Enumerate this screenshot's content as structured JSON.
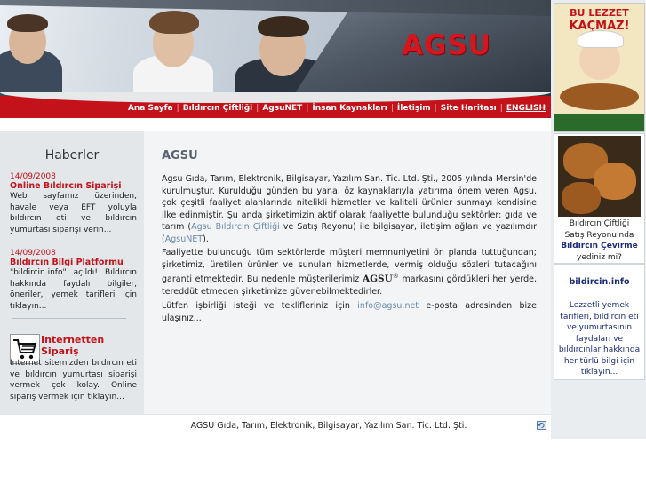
{
  "brand": {
    "logo_text": "AGSU",
    "accent_red": "#c4121a",
    "nav_blue_text": "#1a2a7a"
  },
  "nav": {
    "items": [
      "Ana Sayfa",
      "Bıldırcın Çiftliği",
      "AgsuNET",
      "İnsan Kaynakları",
      "İletişim",
      "Site Haritası",
      "ENGLISH"
    ]
  },
  "sidebar": {
    "heading": "Haberler",
    "news": [
      {
        "date": "14/09/2008",
        "title": "Online Bıldırcın Siparişi",
        "body": "Web sayfamız üzerinden, havale veya EFT yoluyla bıldırcın eti ve bıldırcın yumurtası siparişi verin..."
      },
      {
        "date": "14/09/2008",
        "title": "Bıldırcın Bilgi Platformu",
        "body": "\"bildircin.info\" açıldı! Bıldırcın hakkında faydalı bilgiler, öneriler, yemek tarifleri için tıklayın..."
      }
    ],
    "promo": {
      "icon": "shopping-cart-icon",
      "title": "Internetten Sipariş",
      "body": "Internet sitemizden bıldırcın eti ve bıldırcın yumurtası siparişi vermek çok kolay. Online sipariş vermek için tıklayın..."
    }
  },
  "main": {
    "title": "AGSU",
    "p1_a": "Agsu Gıda, Tarım, Elektronik, Bilgisayar, Yazılım San. Tic. Ltd. Şti., 2005 yılında Mersin'de kurulmuştur. Kurulduğu günden bu yana, öz kaynaklarıyla yatırıma önem veren Agsu, çok çeşitli faaliyet alanlarında nitelikli hizmetler ve kaliteli ürünler sunmayı kendisine ilke edinmiştir. Şu anda şirketimizin aktif olarak faaliyette bulunduğu sektörler: gıda ve tarım (",
    "p1_link1": "Agsu Bıldırcın Çiftliği",
    "p1_b": " ve Satış Reyonu) ile bilgisayar, iletişim ağları ve yazılımdır (",
    "p1_link2": "AgsuNET",
    "p1_c": ").",
    "p2_a": "Faaliyette bulunduğu tüm sektörlerde müşteri memnuniyetini ön planda tuttuğundan; şirketimiz, üretilen ürünler ve sunulan hizmetlerde, vermiş olduğu sözleri tutacağını garanti etmektedir. Bu nedenle müşterilerimiz ",
    "p2_brand": "AGSU",
    "p2_reg": "®",
    "p2_b": " markasını gördükleri her yerde, tereddüt etmeden şirketimize güvenebilmektedirler.",
    "p3_a": "Lütfen işbirliği isteği ve teklifleriniz için ",
    "p3_email": "info@agsu.net",
    "p3_b": " e-posta adresinden bize ulaşınız..."
  },
  "footer": {
    "text": "AGSU Gıda, Tarım, Elektronik, Bilgisayar, Yazılım San. Tic. Ltd. Şti.",
    "icon": "refresh-icon"
  },
  "right": {
    "ad1": {
      "line1": "BU LEZZET",
      "line2": "KAÇMAZ!"
    },
    "ad2": {
      "l1": "Bıldırcın Çiftliği",
      "l2": "Satış Reyonu'nda",
      "l3": "Bıldırcın Çevirme",
      "l4": "yediniz mi?"
    },
    "ad3": {
      "head": "bildircin.info",
      "body": "Lezzetli yemek tarifleri, bıldırcın eti ve yumurtasının faydaları ve bıldırcınlar hakkında her türlü bilgi için tıklayın..."
    }
  }
}
